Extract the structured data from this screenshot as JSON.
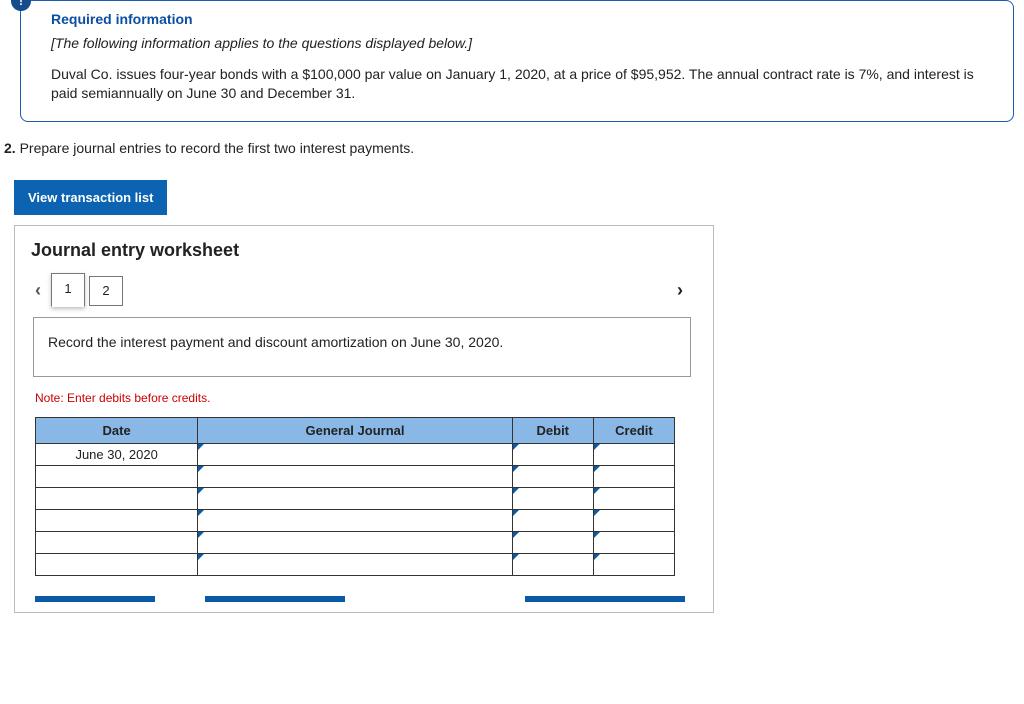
{
  "info": {
    "title": "Required information",
    "applies": "[The following information applies to the questions displayed below.]",
    "body": "Duval Co. issues four-year bonds with a $100,000 par value on January 1, 2020, at a price of $95,952. The annual contract rate is 7%, and interest is paid semiannually on June 30 and December 31."
  },
  "question": {
    "number": "2.",
    "text": "Prepare journal entries to record the first two interest payments."
  },
  "buttons": {
    "view_transaction_list": "View transaction list"
  },
  "worksheet": {
    "title": "Journal entry worksheet",
    "tabs": [
      "1",
      "2"
    ],
    "active_tab": "1",
    "instruction": "Record the interest payment and discount amortization on June 30, 2020.",
    "note": "Note: Enter debits before credits.",
    "table": {
      "headers": {
        "date": "Date",
        "gj": "General Journal",
        "debit": "Debit",
        "credit": "Credit"
      },
      "rows": [
        {
          "date": "June 30, 2020",
          "gj": "",
          "debit": "",
          "credit": ""
        },
        {
          "date": "",
          "gj": "",
          "debit": "",
          "credit": ""
        },
        {
          "date": "",
          "gj": "",
          "debit": "",
          "credit": ""
        },
        {
          "date": "",
          "gj": "",
          "debit": "",
          "credit": ""
        },
        {
          "date": "",
          "gj": "",
          "debit": "",
          "credit": ""
        },
        {
          "date": "",
          "gj": "",
          "debit": "",
          "credit": ""
        }
      ]
    }
  }
}
